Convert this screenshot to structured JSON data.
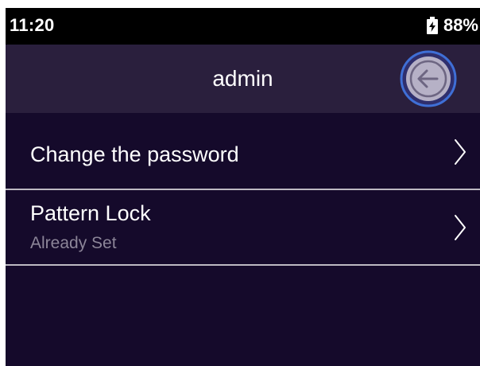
{
  "statusbar": {
    "time": "11:20",
    "battery_percent": "88%",
    "battery_icon": "battery-charging-icon"
  },
  "header": {
    "title": "admin",
    "back_icon": "arrow-left-icon"
  },
  "settings": {
    "items": [
      {
        "title": "Change the password",
        "chevron_icon": "chevron-right-icon"
      },
      {
        "title": "Pattern Lock",
        "subtitle": "Already Set",
        "chevron_icon": "chevron-right-icon"
      }
    ]
  },
  "colors": {
    "background": "#150a2b",
    "header_background": "#2a1f3d",
    "status_background": "#000000",
    "back_button_accent": "#3f6fd6",
    "subtitle": "#8c8598"
  }
}
